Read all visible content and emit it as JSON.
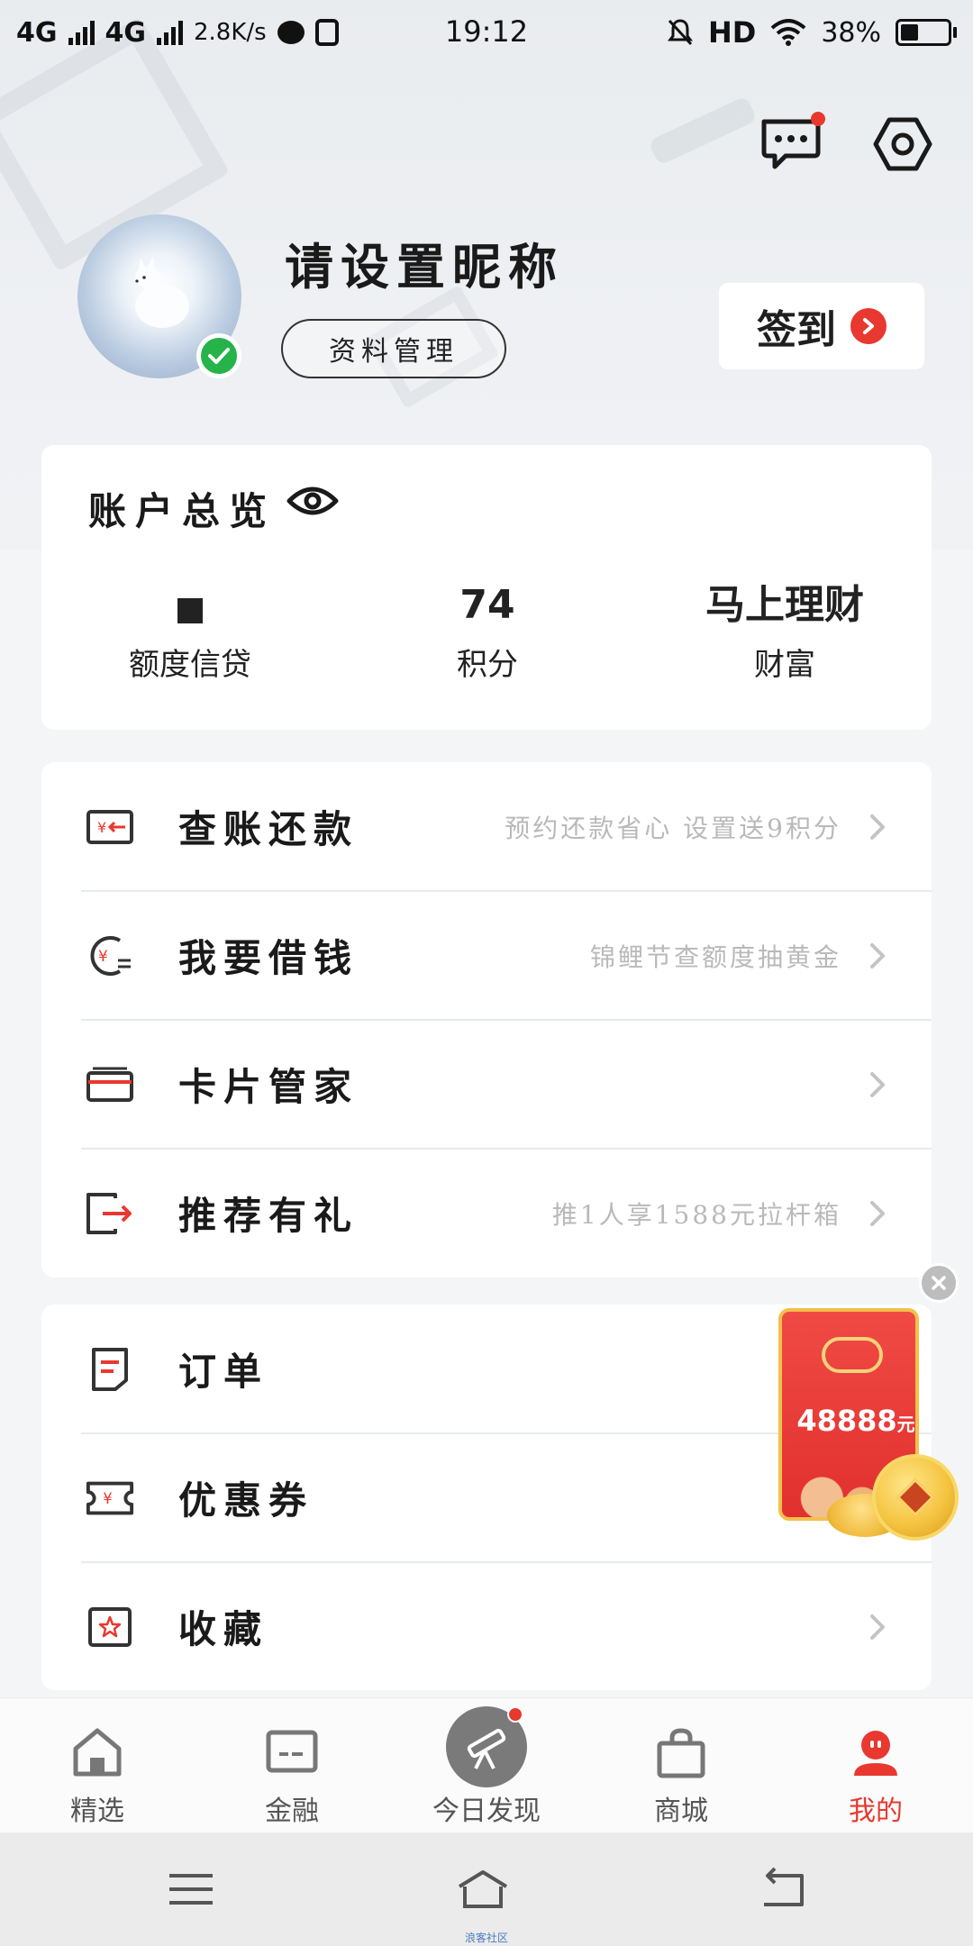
{
  "status_bar": {
    "net1": "4G",
    "net2": "4G",
    "speed": "2.8K/s",
    "time": "19:12",
    "hd": "HD",
    "battery": "38%"
  },
  "profile": {
    "nickname": "请设置昵称",
    "manage_label": "资料管理",
    "signin_label": "签到"
  },
  "overview": {
    "title": "账户总览",
    "items": [
      {
        "value": "",
        "label": "额度信贷"
      },
      {
        "value": "74",
        "label": "积分"
      },
      {
        "value": "马上理财",
        "label": "财富"
      }
    ]
  },
  "menu1": [
    {
      "label": "查账还款",
      "hint": "预约还款省心 设置送9积分",
      "icon": "bill-repay-icon"
    },
    {
      "label": "我要借钱",
      "hint": "锦鲤节查额度抽黄金",
      "icon": "borrow-money-icon"
    },
    {
      "label": "卡片管家",
      "hint": "",
      "icon": "card-icon"
    },
    {
      "label": "推荐有礼",
      "hint": "推1人享1588元拉杆箱",
      "icon": "share-exit-icon"
    }
  ],
  "menu2": [
    {
      "label": "订单",
      "hint": "",
      "icon": "order-doc-icon"
    },
    {
      "label": "优惠券",
      "hint": "",
      "icon": "coupon-icon"
    },
    {
      "label": "收藏",
      "hint": "",
      "icon": "star-box-icon"
    }
  ],
  "red_packet": {
    "amount": "48888",
    "unit": "元"
  },
  "bottom_nav": [
    {
      "label": "精选",
      "icon": "home-icon"
    },
    {
      "label": "金融",
      "icon": "card-finance-icon"
    },
    {
      "label": "今日发现",
      "icon": "telescope-icon"
    },
    {
      "label": "商城",
      "icon": "shopping-bag-icon"
    },
    {
      "label": "我的",
      "icon": "profile-face-icon"
    }
  ],
  "system_nav": {
    "caption": "浪客社区"
  },
  "colors": {
    "accent": "#e8382f",
    "verified": "#25b34a",
    "gold": "#f3c04c"
  }
}
